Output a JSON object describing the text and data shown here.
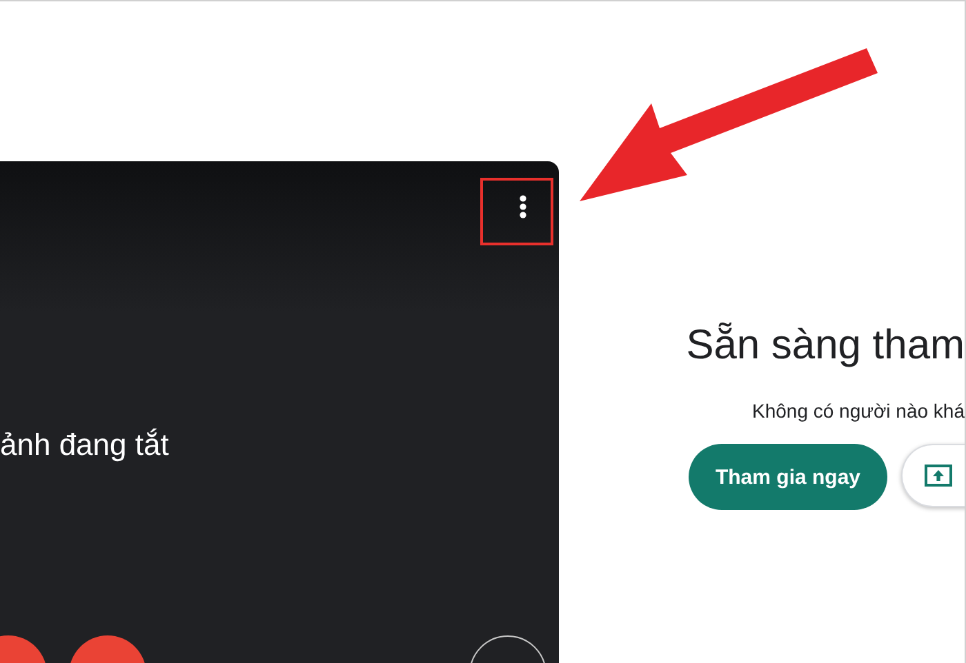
{
  "preview": {
    "status_text": "ảnh đang tắt",
    "controls": [
      {
        "kind": "mic"
      },
      {
        "kind": "camera"
      },
      {
        "kind": "effects"
      }
    ]
  },
  "join_panel": {
    "title": "Sẵn sàng tham",
    "subtitle": "Không có người nào khá",
    "join_button": "Tham gia ngay"
  }
}
